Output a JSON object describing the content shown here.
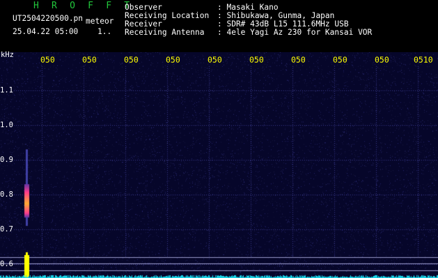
{
  "app": {
    "title": "H R O F F T",
    "filename": "UT2504220500.pn",
    "datetime": "25.04.22 05:00",
    "meteor_label": "meteor",
    "counter": "1.."
  },
  "info": [
    {
      "label": "Observer",
      "value": ": Masaki Kano"
    },
    {
      "label": "Receiving Location",
      "value": ": Shibukawa, Gunma, Japan"
    },
    {
      "label": "Receiver",
      "value": ": SDR# 43dB L15 111.6MHz USB"
    },
    {
      "label": "Receiving Antenna",
      "value": ": 4ele Yagi Az 230 for Kansai VOR"
    }
  ],
  "axis": {
    "unit": "kHz",
    "time_ticks": [
      "050",
      "050",
      "050",
      "050",
      "050",
      "050",
      "050",
      "050",
      "050",
      "0510"
    ],
    "freq_ticks": [
      "1.1",
      "1.0",
      "0.9",
      "0.8",
      "0.7",
      "0.6"
    ]
  },
  "colors": {
    "background": "#06062a",
    "grid": "#3a3a8c",
    "title": "#22c83c",
    "time_tick": "#ffff00",
    "reference_line": "#9a9acc",
    "baseline": "#19d2e6",
    "meteor_echo": "#ff3c8c",
    "carrier": "#ffff00"
  }
}
